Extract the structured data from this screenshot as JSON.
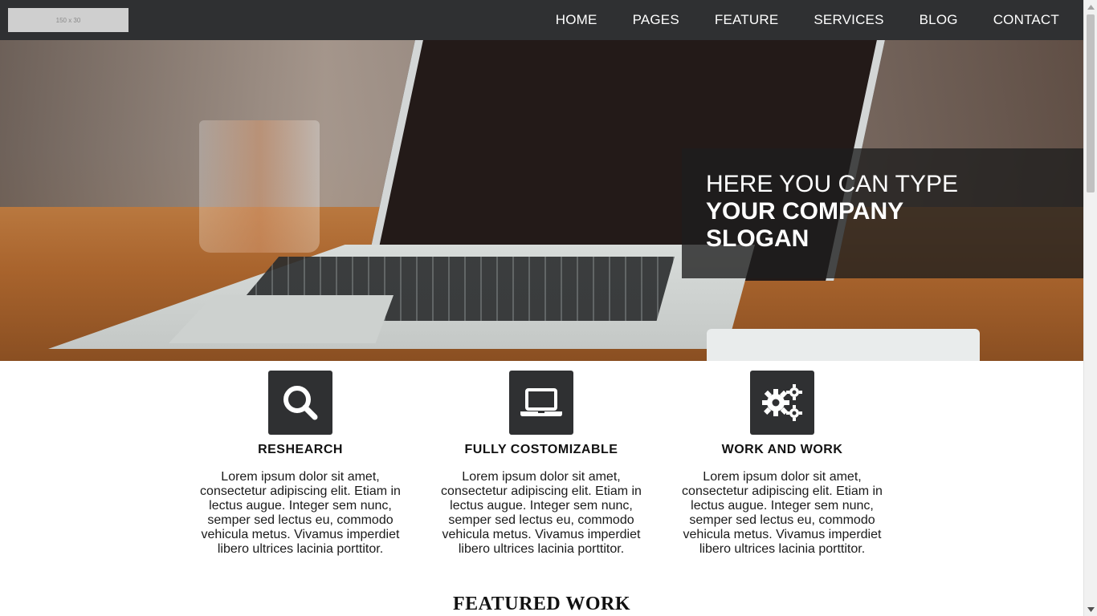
{
  "header": {
    "logo_text": "150 x 30",
    "nav": [
      {
        "label": "HOME"
      },
      {
        "label": "PAGES"
      },
      {
        "label": "FEATURE"
      },
      {
        "label": "SERVICES"
      },
      {
        "label": "BLOG"
      },
      {
        "label": "CONTACT"
      }
    ]
  },
  "hero": {
    "slogan_line1": "HERE YOU CAN TYPE",
    "slogan_line2": "YOUR COMPANY SLOGAN"
  },
  "features": [
    {
      "icon": "search-icon",
      "title": "RESHEARCH",
      "text": "Lorem ipsum dolor sit amet, consectetur adipiscing elit. Etiam in lectus augue. Integer sem nunc, semper sed lectus eu, commodo vehicula metus. Vivamus imperdiet libero ultrices lacinia porttitor."
    },
    {
      "icon": "laptop-icon",
      "title": "FULLY COSTOMIZABLE",
      "text": "Lorem ipsum dolor sit amet, consectetur adipiscing elit. Etiam in lectus augue. Integer sem nunc, semper sed lectus eu, commodo vehicula metus. Vivamus imperdiet libero ultrices lacinia porttitor."
    },
    {
      "icon": "gears-icon",
      "title": "WORK AND WORK",
      "text": "Lorem ipsum dolor sit amet, consectetur adipiscing elit. Etiam in lectus augue. Integer sem nunc, semper sed lectus eu, commodo vehicula metus. Vivamus imperdiet libero ultrices lacinia porttitor."
    }
  ],
  "featured_work": {
    "title": "FEATURED WORK"
  },
  "colors": {
    "navbar_bg": "#2f3032",
    "icon_box_bg": "#2f3032",
    "slogan_overlay": "#1e1e1e"
  }
}
